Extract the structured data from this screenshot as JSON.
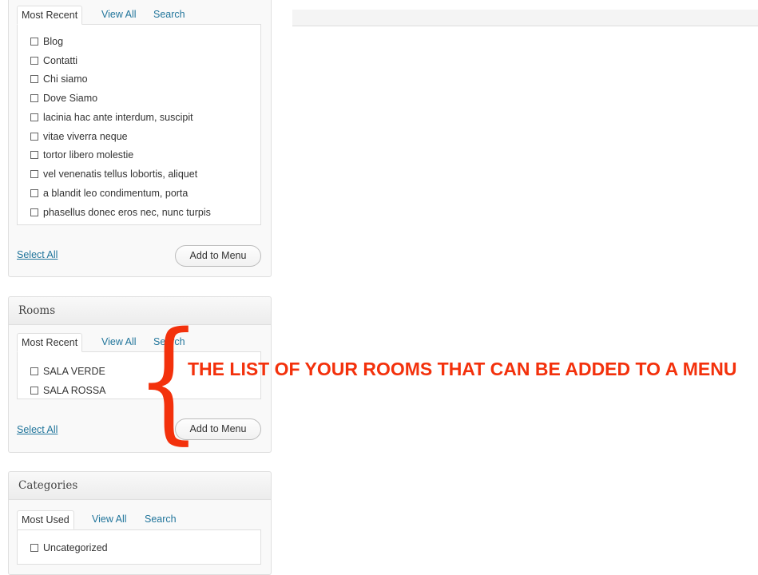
{
  "pages_box": {
    "tabs": [
      "Most Recent",
      "View All",
      "Search"
    ],
    "items": [
      "Blog",
      "Contatti",
      "Chi siamo",
      "Dove Siamo",
      "lacinia hac ante interdum, suscipit",
      "vitae viverra neque",
      "tortor libero molestie",
      "vel venenatis tellus lobortis, aliquet",
      "a blandit leo condimentum, porta",
      "phasellus donec eros nec, nunc turpis"
    ],
    "select_all": "Select All",
    "add_button": "Add to Menu"
  },
  "rooms_box": {
    "title": "Rooms",
    "tabs": [
      "Most Recent",
      "View All",
      "Search"
    ],
    "items": [
      "SALA VERDE",
      "SALA ROSSA"
    ],
    "select_all": "Select All",
    "add_button": "Add to Menu"
  },
  "categories_box": {
    "title": "Categories",
    "tabs": [
      "Most Used",
      "View All",
      "Search"
    ],
    "items": [
      "Uncategorized"
    ]
  },
  "annotation": {
    "text": "THE LIST OF YOUR ROOMS THAT CAN BE ADDED TO A MENU",
    "brace": "{",
    "color": "#f3310c"
  },
  "link_color": "#21759b"
}
